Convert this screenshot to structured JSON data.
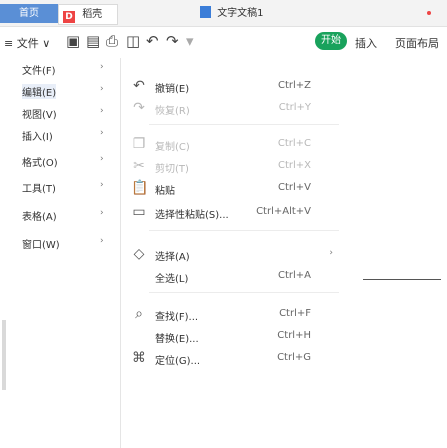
{
  "tabbar": {
    "home_label": "首页",
    "wps_label": "稻壳",
    "wps_logo": "D",
    "doc_label": "文字文稿1"
  },
  "toolbar": {
    "file_menu": "≡ 文件 ∨",
    "insert": "插入",
    "page": "页面布局",
    "start_badge": "开始"
  },
  "left_menu": {
    "items": [
      "文件(F)",
      "编辑(E)",
      "视图(V)",
      "插入(I)",
      "格式(O)",
      "工具(T)",
      "表格(A)",
      "窗口(W)"
    ]
  },
  "edit_submenu": {
    "items": [
      {
        "icon": "undo-icon",
        "label": "撤销(E)",
        "shortcut": "Ctrl+Z",
        "disabled": false
      },
      {
        "icon": "redo-icon",
        "label": "恢复(R)",
        "shortcut": "Ctrl+Y",
        "disabled": true
      },
      {
        "icon": "copy-icon",
        "label": "复制(C)",
        "shortcut": "Ctrl+C",
        "disabled": true
      },
      {
        "icon": "cut-icon",
        "label": "剪切(T)",
        "shortcut": "Ctrl+X",
        "disabled": true
      },
      {
        "icon": "paste-icon",
        "label": "粘贴",
        "shortcut": "Ctrl+V",
        "disabled": false
      },
      {
        "icon": "paste-special-icon",
        "label": "选择性粘贴(S)...",
        "shortcut": "Ctrl+Alt+V",
        "disabled": false
      },
      {
        "icon": "select-icon",
        "label": "选择(A)",
        "shortcut": "",
        "disabled": false
      },
      {
        "icon": "",
        "label": "全选(L)",
        "shortcut": "Ctrl+A",
        "disabled": false
      },
      {
        "icon": "find-icon",
        "label": "查找(F)...",
        "shortcut": "Ctrl+F",
        "disabled": false
      },
      {
        "icon": "",
        "label": "替换(E)...",
        "shortcut": "Ctrl+H",
        "disabled": false
      },
      {
        "icon": "goto-icon",
        "label": "定位(G)...",
        "shortcut": "Ctrl+G",
        "disabled": false
      }
    ]
  }
}
